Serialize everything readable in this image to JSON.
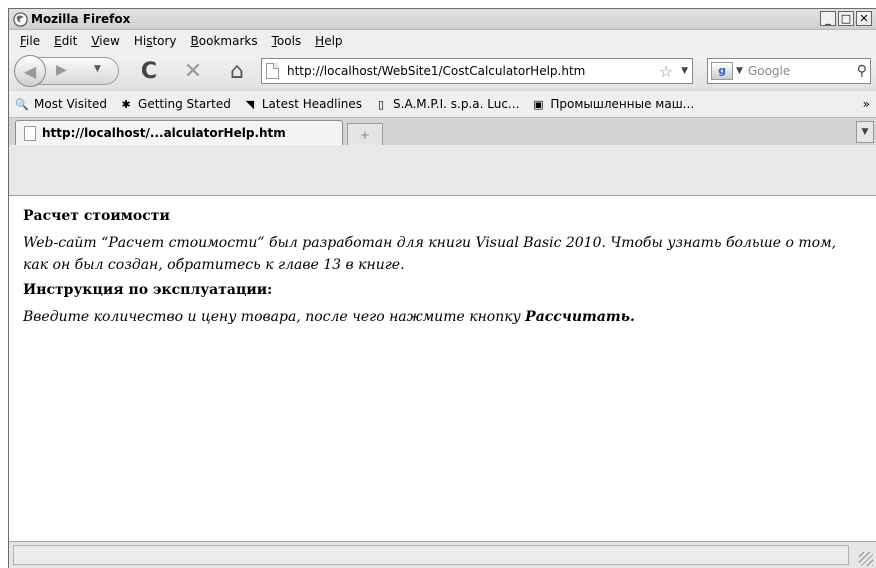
{
  "window": {
    "title": "Mozilla Firefox"
  },
  "menu": [
    {
      "pre": "",
      "key": "F",
      "post": "ile"
    },
    {
      "pre": "",
      "key": "E",
      "post": "dit"
    },
    {
      "pre": "",
      "key": "V",
      "post": "iew"
    },
    {
      "pre": "Hi",
      "key": "s",
      "post": "tory"
    },
    {
      "pre": "",
      "key": "B",
      "post": "ookmarks"
    },
    {
      "pre": "",
      "key": "T",
      "post": "ools"
    },
    {
      "pre": "",
      "key": "H",
      "post": "elp"
    }
  ],
  "nav": {
    "url": "http://localhost/WebSite1/CostCalculatorHelp.htm",
    "search_placeholder": "Google"
  },
  "bookmarks": [
    "Most Visited",
    "Getting Started",
    "Latest Headlines",
    "S.A.M.P.I. s.p.a. Luc...",
    "Промышленные маш..."
  ],
  "bookmarks_more": "»",
  "tab": {
    "label": "http://localhost/...alculatorHelp.htm",
    "new_tab": "+"
  },
  "page": {
    "heading1": "Расчет стоимости",
    "para1": "Web-сайт “Расчет стоимости” был разработан для книги Visual Basic 2010. Чтобы узнать больше о том, как он был создан, обратитесь к главе 13 в книге.",
    "heading2": "Инструкция по эксплуатации:",
    "para2_before": "Введите количество и цену товара, после чего нажмите кнопку ",
    "para2_bold": "Рассчитать",
    "para2_after": "."
  }
}
